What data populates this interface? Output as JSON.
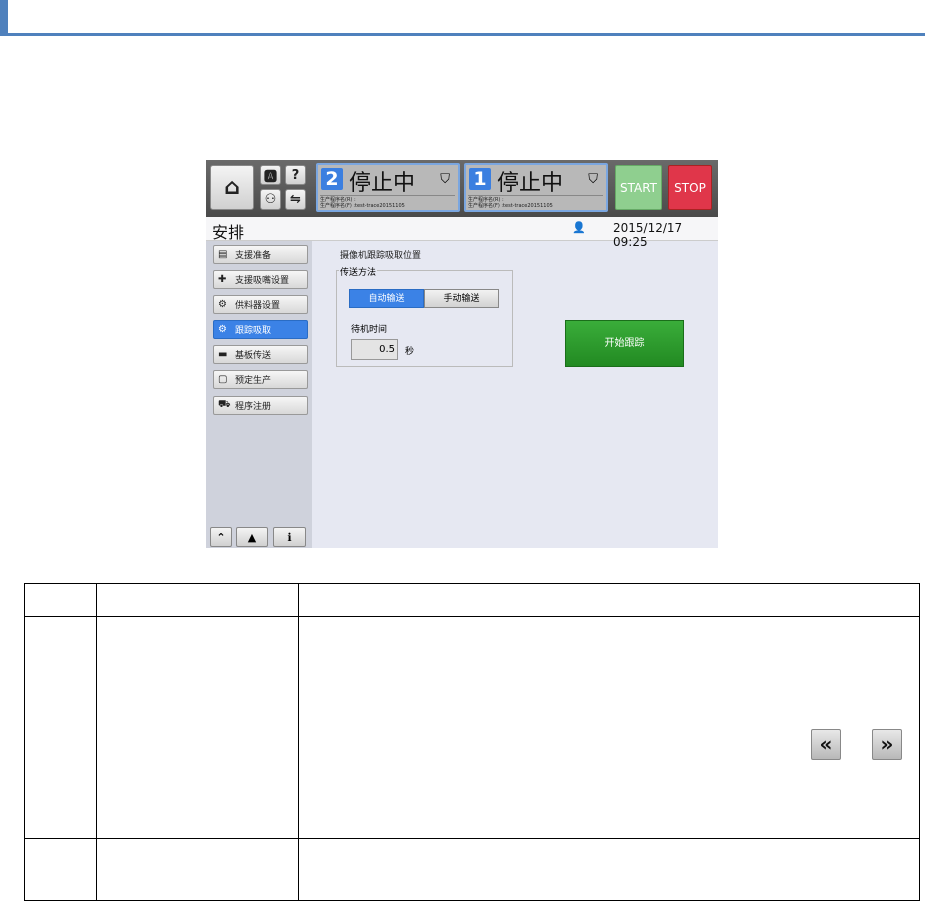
{
  "colors": {
    "accent": "#4f81bd",
    "active_blue": "#3b82e6",
    "start": "#8fcf8f",
    "stop": "#e0364a",
    "go": "#2e9e2e"
  },
  "topbar": {
    "home_icon": "home-icon",
    "small_buttons": [
      {
        "label": "🅰",
        "icon": "language-icon"
      },
      {
        "label": "?",
        "icon": "help-icon"
      },
      {
        "label": "⚇",
        "icon": "users-icon"
      },
      {
        "label": "⇋",
        "icon": "transfer-icon"
      }
    ],
    "lanes": [
      {
        "number": "2",
        "status": "停止中",
        "line1": "生产程序名(R) :",
        "line2": "生产程序名(F) :test-trace20151105"
      },
      {
        "number": "1",
        "status": "停止中",
        "line1": "生产程序名(R) :",
        "line2": "生产程序名(F) :test-trace20151105"
      }
    ],
    "start_label": "START",
    "stop_label": "STOP"
  },
  "title": "安排",
  "datetime": "2015/12/17 09:25",
  "sidebar": {
    "items": [
      {
        "label": "支援准备",
        "icon": "▤"
      },
      {
        "label": "支援吸嘴设置",
        "icon": "✚"
      },
      {
        "label": "供料器设置",
        "icon": "⚙"
      },
      {
        "label": "跟踪吸取",
        "icon": "⚙"
      },
      {
        "label": "基板传送",
        "icon": "▬"
      },
      {
        "label": "预定生产",
        "icon": "▢"
      },
      {
        "label": "程序注册",
        "icon": "⛟"
      }
    ],
    "bottom": [
      "⌃",
      "▲",
      "ℹ"
    ]
  },
  "main": {
    "heading": "摄像机跟踪吸取位置",
    "group_label": "传送方法",
    "auto_label": "自动输送",
    "manual_label": "手动输送",
    "wait_label": "待机时间",
    "wait_value": "0.5",
    "unit": "秒",
    "start_tracking": "开始跟踪"
  },
  "table": {
    "prev": "«",
    "next": "»"
  }
}
